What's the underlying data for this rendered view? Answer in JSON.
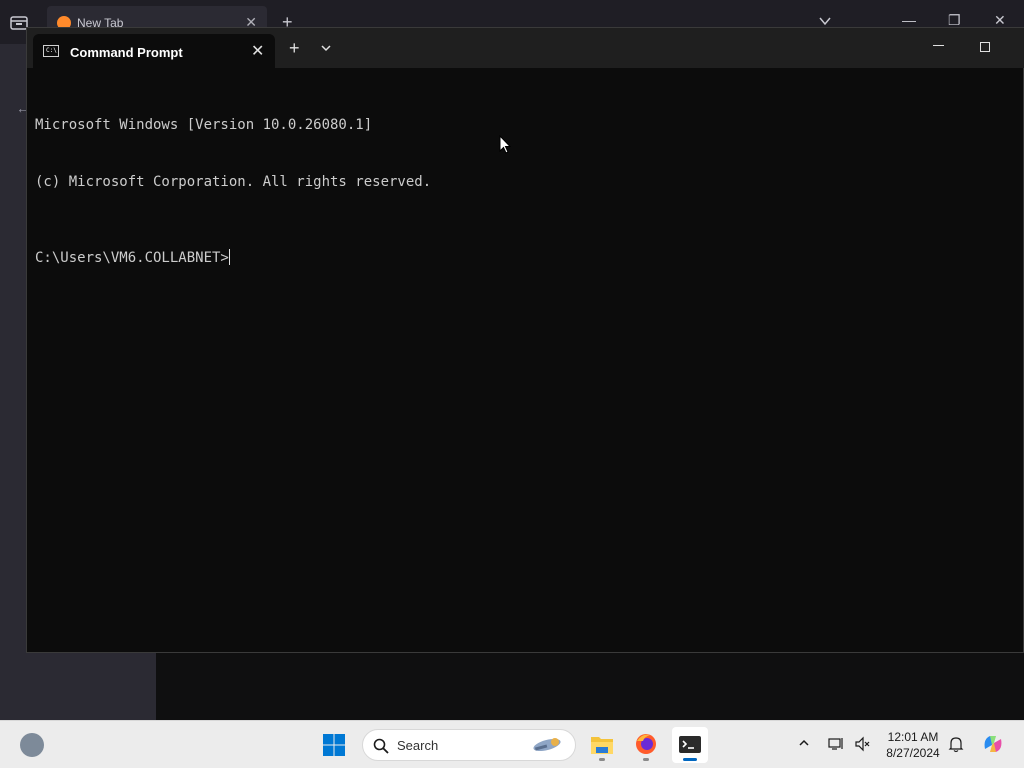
{
  "browser": {
    "tab_label": "New Tab",
    "tab_close": "✕",
    "new_tab": "+",
    "minimize": "—",
    "restore": "❐",
    "close": "✕",
    "back": "←"
  },
  "terminal": {
    "tab_title": "Command Prompt",
    "tab_icon_text": "C:\\",
    "tab_close": "✕",
    "new_tab": "+",
    "lines": [
      "Microsoft Windows [Version 10.0.26080.1]",
      "(c) Microsoft Corporation. All rights reserved."
    ],
    "prompt": "C:\\Users\\VM6.COLLABNET>"
  },
  "taskbar": {
    "search_placeholder": "Search",
    "time": "12:01 AM",
    "date": "8/27/2024",
    "accent": "#0067c0"
  }
}
